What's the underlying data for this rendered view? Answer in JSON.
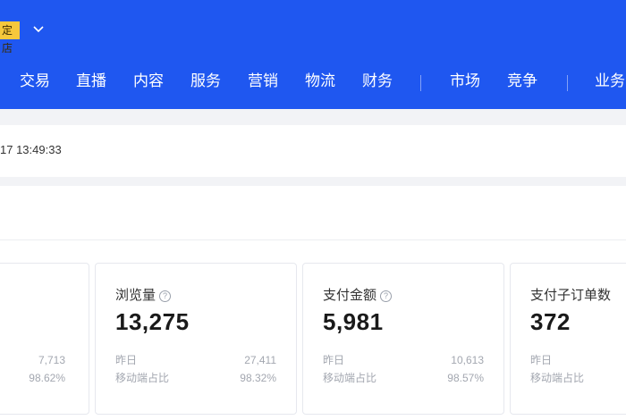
{
  "header": {
    "shop_badge": "定店",
    "nav_items": [
      "交易",
      "直播",
      "内容",
      "服务",
      "营销",
      "物流",
      "财务",
      "市场",
      "竞争",
      "业务"
    ]
  },
  "timebar": {
    "text": "17 13:49:33"
  },
  "cards": [
    {
      "yesterday_value": "7,713",
      "mobile_ratio": "98.62%"
    },
    {
      "title": "浏览量",
      "value": "13,275",
      "yesterday_label": "昨日",
      "yesterday_value": "27,411",
      "mobile_label": "移动端占比",
      "mobile_ratio": "98.32%"
    },
    {
      "title": "支付金额",
      "value": "5,981",
      "yesterday_label": "昨日",
      "yesterday_value": "10,613",
      "mobile_label": "移动端占比",
      "mobile_ratio": "98.57%"
    },
    {
      "title": "支付子订单数",
      "value": "372",
      "yesterday_label": "昨日",
      "mobile_label": "移动端占比"
    }
  ],
  "colors": {
    "header_bg": "#1f57f0",
    "badge_bg": "#f6c83c",
    "muted_text": "#a3a7b0"
  }
}
